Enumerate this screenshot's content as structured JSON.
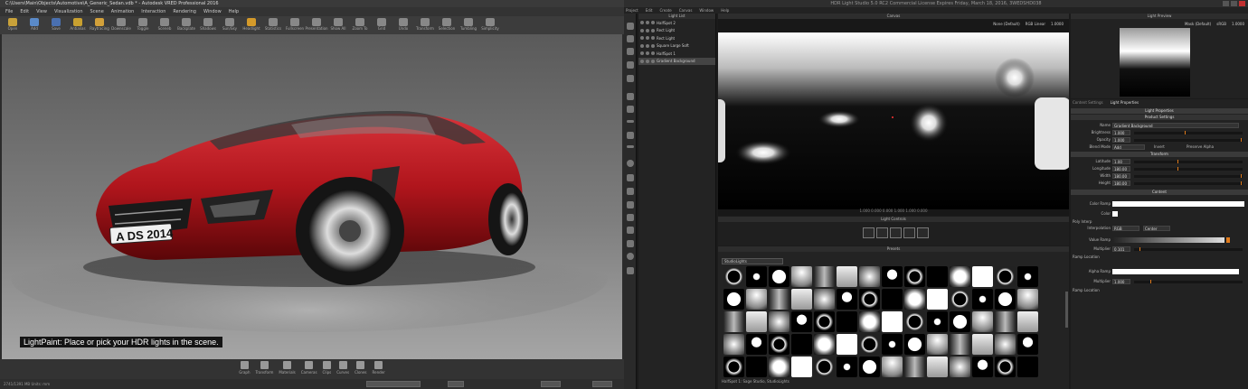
{
  "left_app": {
    "title": "C:\\Users\\Main\\Objects\\Automotive\\A_Generic_Sedan.vdb * - Autodesk VRED Professional 2016",
    "menu": [
      "File",
      "Edit",
      "View",
      "Visualization",
      "Scene",
      "Animation",
      "Interaction",
      "Rendering",
      "Window",
      "Help"
    ],
    "toolbar": [
      "Open",
      "Add",
      "Save",
      "Antialias",
      "Raytracing",
      "Downscale",
      "Toggle",
      "Sceneb",
      "Backplate",
      "Shadows",
      "Sun/Sky",
      "Headlight",
      "Statistics",
      "Fullscreen",
      "Presentation",
      "Show All",
      "Zoom To",
      "Grid",
      "Undo",
      "Transform",
      "Selection",
      "Tumbling",
      "Simplicity"
    ],
    "caption": "LightPaint: Place or pick your HDR lights in the scene.",
    "plate": "A DS 2014",
    "bottom_tools": [
      "Graph",
      "Transform",
      "Materials",
      "Cameras",
      "Clips",
      "Curves",
      "Clones",
      "Render"
    ],
    "status": "2741/1391 MB  Units: mm"
  },
  "right_app": {
    "title": "HDR Light Studio 5.0 RC2 Commercial License Expires Friday, March 18, 2016, 3WEDSHD038",
    "menu": [
      "Project",
      "Edit",
      "Create",
      "Canvas",
      "Window",
      "Help"
    ],
    "light_list_header": "Light List",
    "lights": [
      "HalfSpot 2",
      "Rect Light",
      "Rect Light",
      "Square Large Soft",
      "HalfSpot 1",
      "Gradient Background"
    ],
    "canvas_header": "Canvas",
    "canvas_opts": [
      "None (Default)",
      "RGB Linear",
      "1.0000"
    ],
    "canvas_status": "1.000   0.000   0.000   1.000   1.000   0.000",
    "controls_header": "Light Controls",
    "presets_header": "Presets",
    "presets_filter": "StudioLights",
    "presets_status": "HalfSpot 1: Sage Studio, StudioLights",
    "preview_header": "Light Preview",
    "preview_opts": [
      "Mask (Default)",
      "sRGB",
      "1.0000"
    ],
    "tabs": [
      "Content Settings",
      "Light Properties"
    ],
    "light_properties_header": "Light Properties",
    "product_settings": "Product Settings",
    "name_label": "Name",
    "name_value": "Gradient Background",
    "brightness_label": "Brightness",
    "brightness_value": "1.000",
    "opacity_label": "Opacity",
    "opacity_value": "1.000",
    "blend_label": "Blend Mode",
    "blend_value": "Add",
    "invert_label": "Invert",
    "preserve_label": "Preserve Alpha",
    "transform": "Transform",
    "latitude_label": "Latitude",
    "latitude_value": "1.00",
    "longitude_label": "Longitude",
    "longitude_value": "180.00",
    "width_label": "Width",
    "width_value": "180.00",
    "height_label": "Height",
    "height_value": "180.00",
    "content": "Content",
    "color_ramp_label": "Color Ramp",
    "color_label": "Color",
    "polyinterp_label": "Poly Interp",
    "interp_label": "Interpolation",
    "interp_value": "RGB",
    "center_value": "Center",
    "value_ramp_label": "Value Ramp",
    "mult_label": "Multiplier",
    "mult_value": "0.101",
    "ramp_loc_label": "Ramp Location",
    "alpha_ramp_label": "Alpha Ramp",
    "mult2_value": "1.000",
    "ramp_loc2_label": "Ramp Location"
  },
  "colors": {
    "car_red": "#b0151c",
    "accent_orange": "#e07a1a"
  }
}
